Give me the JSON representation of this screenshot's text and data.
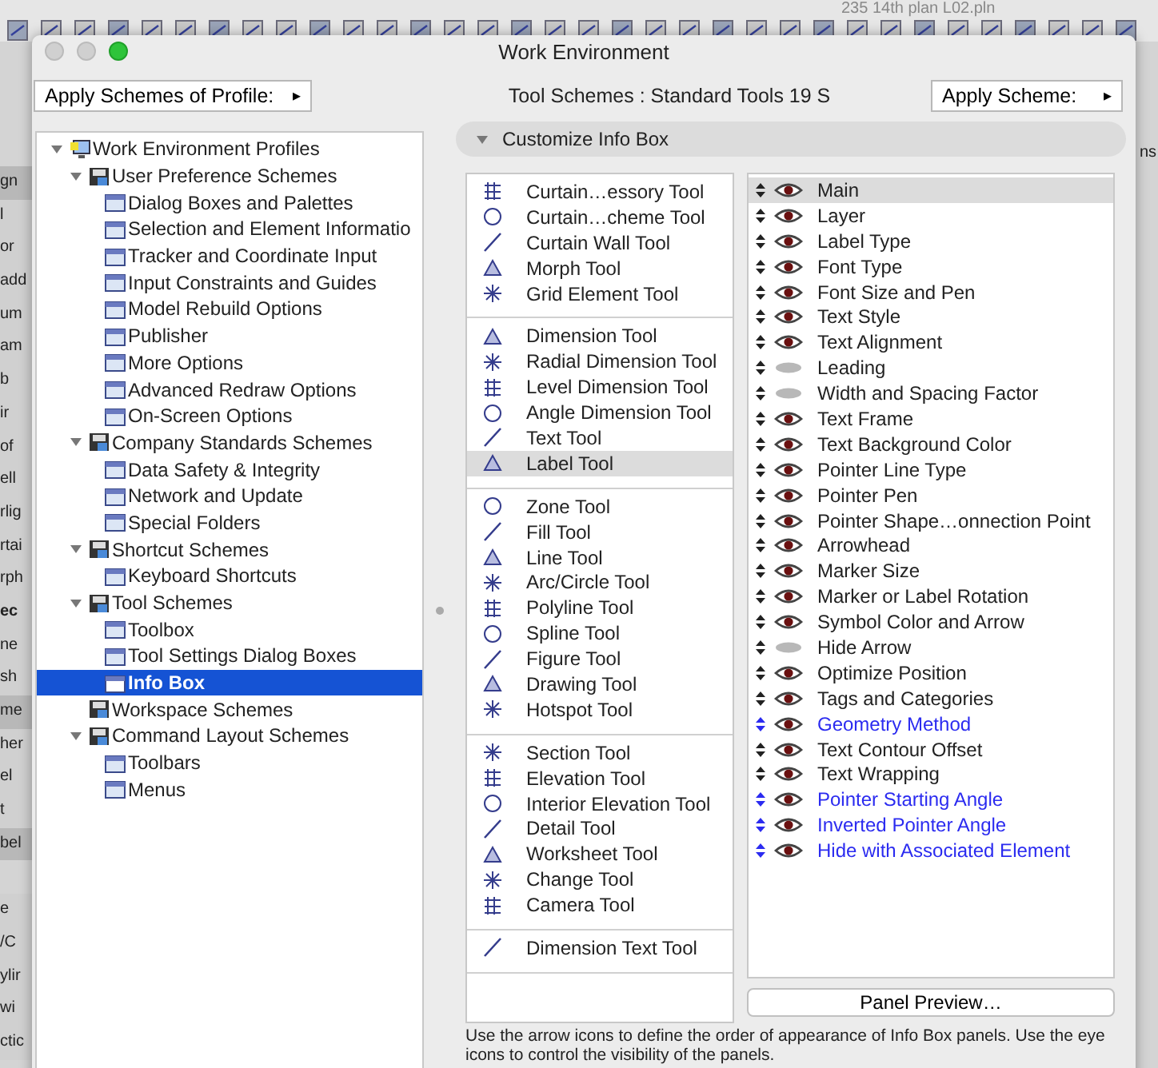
{
  "background": {
    "file_name": "235 14th plan L02.pln",
    "right_label": "ns",
    "side_labels": [
      {
        "text": "gn",
        "kind": "header"
      },
      {
        "text": "l",
        "kind": "row"
      },
      {
        "text": "or",
        "kind": "row"
      },
      {
        "text": "add",
        "kind": "row"
      },
      {
        "text": "um",
        "kind": "row"
      },
      {
        "text": "am",
        "kind": "row"
      },
      {
        "text": "b",
        "kind": "row"
      },
      {
        "text": "ir",
        "kind": "row"
      },
      {
        "text": "of",
        "kind": "row"
      },
      {
        "text": "ell",
        "kind": "row"
      },
      {
        "text": "rlig",
        "kind": "row"
      },
      {
        "text": "rtai",
        "kind": "row"
      },
      {
        "text": "rph",
        "kind": "row"
      },
      {
        "text": "ec",
        "kind": "bold"
      },
      {
        "text": "ne",
        "kind": "row"
      },
      {
        "text": "sh",
        "kind": "row"
      },
      {
        "text": "me",
        "kind": "header"
      },
      {
        "text": "her",
        "kind": "row"
      },
      {
        "text": "el",
        "kind": "row"
      },
      {
        "text": "t",
        "kind": "row"
      },
      {
        "text": "bel",
        "kind": "header"
      },
      {
        "text": "e",
        "kind": "gap"
      },
      {
        "text": "/C",
        "kind": "row"
      },
      {
        "text": "ylir",
        "kind": "row"
      },
      {
        "text": "wi",
        "kind": "row"
      },
      {
        "text": "ctic",
        "kind": "row"
      }
    ]
  },
  "window": {
    "title": "Work Environment"
  },
  "header": {
    "profile_button": "Apply Schemes of Profile:",
    "scheme_label": "Tool Schemes :",
    "scheme_value": "Standard Tools 19 S",
    "apply_button": "Apply Scheme:",
    "arrow": "▸"
  },
  "tree": [
    {
      "label": "Work Environment Profiles",
      "expanded": true,
      "selected": false,
      "children": [
        {
          "label": "User Preference Schemes",
          "expanded": true,
          "selected": false,
          "children": [
            {
              "label": "Dialog Boxes and Palettes",
              "selected": false
            },
            {
              "label": "Selection and Element Informatio",
              "selected": false
            },
            {
              "label": "Tracker and Coordinate Input",
              "selected": false
            },
            {
              "label": "Input Constraints and Guides",
              "selected": false
            },
            {
              "label": "Model Rebuild Options",
              "selected": false
            },
            {
              "label": "Publisher",
              "selected": false
            },
            {
              "label": "More Options",
              "selected": false
            },
            {
              "label": "Advanced Redraw Options",
              "selected": false
            },
            {
              "label": "On-Screen Options",
              "selected": false
            }
          ]
        },
        {
          "label": "Company Standards Schemes",
          "expanded": true,
          "selected": false,
          "children": [
            {
              "label": "Data Safety & Integrity",
              "selected": false
            },
            {
              "label": "Network and Update",
              "selected": false
            },
            {
              "label": "Special Folders",
              "selected": false
            }
          ]
        },
        {
          "label": "Shortcut Schemes",
          "expanded": true,
          "selected": false,
          "children": [
            {
              "label": "Keyboard Shortcuts",
              "selected": false
            }
          ]
        },
        {
          "label": "Tool Schemes",
          "expanded": true,
          "selected": false,
          "children": [
            {
              "label": "Toolbox",
              "selected": false
            },
            {
              "label": "Tool Settings Dialog Boxes",
              "selected": false
            },
            {
              "label": "Info Box",
              "selected": true
            }
          ]
        },
        {
          "label": "Workspace Schemes",
          "selected": false
        },
        {
          "label": "Command Layout Schemes",
          "expanded": true,
          "selected": false,
          "children": [
            {
              "label": "Toolbars",
              "selected": false
            },
            {
              "label": "Menus",
              "selected": false
            }
          ]
        }
      ]
    }
  ],
  "section": {
    "label": "Customize Info Box",
    "expanded": true
  },
  "tool_groups": [
    [
      {
        "label": "Curtain…essory Tool",
        "selected": false
      },
      {
        "label": "Curtain…cheme Tool",
        "selected": false
      },
      {
        "label": "Curtain Wall Tool",
        "selected": false
      },
      {
        "label": "Morph Tool",
        "selected": false
      },
      {
        "label": "Grid Element Tool",
        "selected": false
      }
    ],
    [
      {
        "label": "Dimension Tool",
        "selected": false
      },
      {
        "label": "Radial Dimension Tool",
        "selected": false
      },
      {
        "label": "Level Dimension Tool",
        "selected": false
      },
      {
        "label": "Angle Dimension Tool",
        "selected": false
      },
      {
        "label": "Text Tool",
        "selected": false
      },
      {
        "label": "Label Tool",
        "selected": true
      }
    ],
    [
      {
        "label": "Zone Tool",
        "selected": false
      },
      {
        "label": "Fill Tool",
        "selected": false
      },
      {
        "label": "Line Tool",
        "selected": false
      },
      {
        "label": "Arc/Circle Tool",
        "selected": false
      },
      {
        "label": "Polyline Tool",
        "selected": false
      },
      {
        "label": "Spline Tool",
        "selected": false
      },
      {
        "label": "Figure Tool",
        "selected": false
      },
      {
        "label": "Drawing Tool",
        "selected": false
      },
      {
        "label": "Hotspot Tool",
        "selected": false
      }
    ],
    [
      {
        "label": "Section Tool",
        "selected": false
      },
      {
        "label": "Elevation Tool",
        "selected": false
      },
      {
        "label": "Interior Elevation Tool",
        "selected": false
      },
      {
        "label": "Detail Tool",
        "selected": false
      },
      {
        "label": "Worksheet Tool",
        "selected": false
      },
      {
        "label": "Change Tool",
        "selected": false
      },
      {
        "label": "Camera Tool",
        "selected": false
      }
    ],
    [
      {
        "label": "Dimension Text Tool",
        "selected": false
      }
    ]
  ],
  "panels": [
    {
      "label": "Main",
      "visible": true,
      "selected": true,
      "color": "#222222"
    },
    {
      "label": "Layer",
      "visible": true,
      "selected": false,
      "color": "#222222"
    },
    {
      "label": "Label Type",
      "visible": true,
      "selected": false,
      "color": "#222222"
    },
    {
      "label": "Font Type",
      "visible": true,
      "selected": false,
      "color": "#222222"
    },
    {
      "label": "Font Size and Pen",
      "visible": true,
      "selected": false,
      "color": "#222222"
    },
    {
      "label": "Text Style",
      "visible": true,
      "selected": false,
      "color": "#222222"
    },
    {
      "label": "Text Alignment",
      "visible": true,
      "selected": false,
      "color": "#222222"
    },
    {
      "label": "Leading",
      "visible": false,
      "selected": false,
      "color": "#222222"
    },
    {
      "label": "Width and Spacing Factor",
      "visible": false,
      "selected": false,
      "color": "#222222"
    },
    {
      "label": "Text Frame",
      "visible": true,
      "selected": false,
      "color": "#222222"
    },
    {
      "label": "Text Background Color",
      "visible": true,
      "selected": false,
      "color": "#222222"
    },
    {
      "label": "Pointer Line Type",
      "visible": true,
      "selected": false,
      "color": "#222222"
    },
    {
      "label": "Pointer Pen",
      "visible": true,
      "selected": false,
      "color": "#222222"
    },
    {
      "label": "Pointer Shape…onnection Point",
      "visible": true,
      "selected": false,
      "color": "#222222"
    },
    {
      "label": "Arrowhead",
      "visible": true,
      "selected": false,
      "color": "#222222"
    },
    {
      "label": "Marker Size",
      "visible": true,
      "selected": false,
      "color": "#222222"
    },
    {
      "label": "Marker or Label Rotation",
      "visible": true,
      "selected": false,
      "color": "#222222"
    },
    {
      "label": "Symbol Color and Arrow",
      "visible": true,
      "selected": false,
      "color": "#222222"
    },
    {
      "label": "Hide Arrow",
      "visible": false,
      "selected": false,
      "color": "#222222"
    },
    {
      "label": "Optimize Position",
      "visible": true,
      "selected": false,
      "color": "#222222"
    },
    {
      "label": "Tags and Categories",
      "visible": true,
      "selected": false,
      "color": "#222222"
    },
    {
      "label": "Geometry Method",
      "visible": true,
      "selected": false,
      "color": "#2b2bf0"
    },
    {
      "label": "Text Contour Offset",
      "visible": true,
      "selected": false,
      "color": "#222222"
    },
    {
      "label": "Text Wrapping",
      "visible": true,
      "selected": false,
      "color": "#222222"
    },
    {
      "label": "Pointer Starting Angle",
      "visible": true,
      "selected": false,
      "color": "#2b2bf0"
    },
    {
      "label": "Inverted Pointer Angle",
      "visible": true,
      "selected": false,
      "color": "#2b2bf0"
    },
    {
      "label": "Hide with Associated Element",
      "visible": true,
      "selected": false,
      "color": "#2b2bf0"
    }
  ],
  "preview_button": "Panel Preview…",
  "footer": "Use the arrow icons to define the order of appearance of Info Box panels. Use the eye icons to control the visibility of the panels."
}
